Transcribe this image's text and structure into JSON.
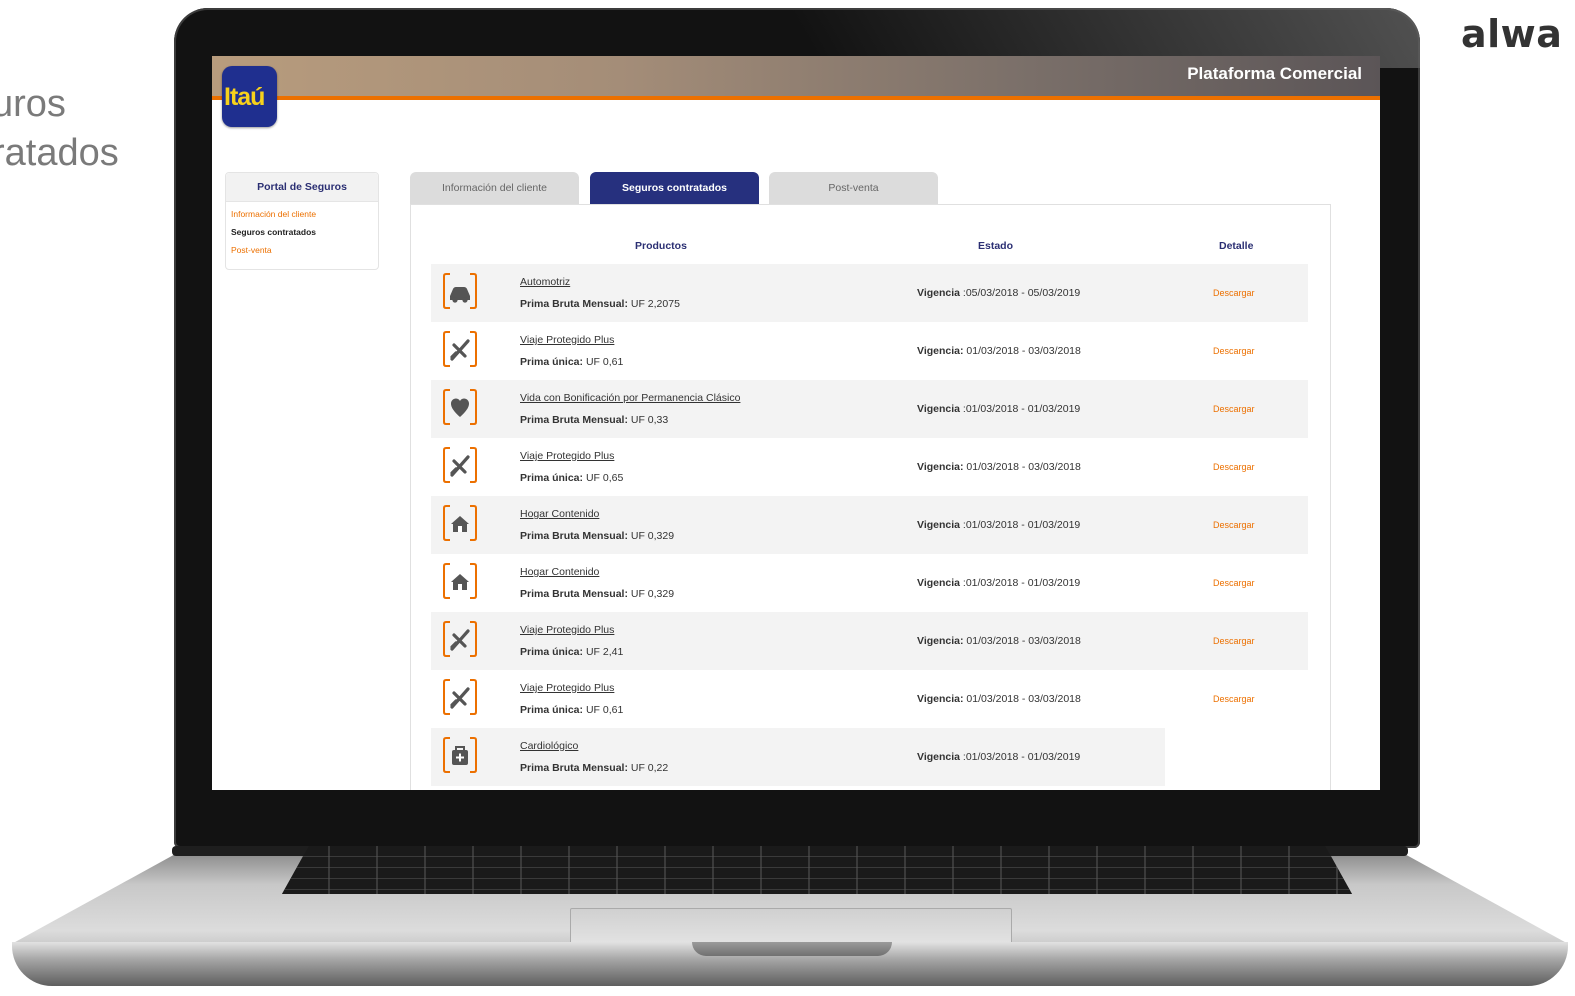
{
  "slide": {
    "title_line1": "uros",
    "title_line2": "ratados",
    "brand_partial": "alwa"
  },
  "header": {
    "logo_text": "Itaú",
    "platform_title": "Plataforma Comercial"
  },
  "sidebar": {
    "title": "Portal de Seguros",
    "items": [
      {
        "label": "Información del cliente",
        "active": false
      },
      {
        "label": "Seguros contratados",
        "active": true
      },
      {
        "label": "Post-venta",
        "active": false
      }
    ]
  },
  "tabs": [
    {
      "label": "Información del cliente",
      "active": false
    },
    {
      "label": "Seguros contratados",
      "active": true
    },
    {
      "label": "Post-venta",
      "active": false
    }
  ],
  "table": {
    "columns": [
      "Productos",
      "Estado",
      "Detalle"
    ],
    "vigencia_label": "Vigencia:",
    "rows": [
      {
        "icon": "car-icon",
        "product": "Automotriz",
        "premium_label": "Prima Bruta Mensual:",
        "premium_value": "UF 2,2075",
        "vigencia_label": "Vigencia",
        "vigencia": ":05/03/2018 - 05/03/2019",
        "action": "Descargar"
      },
      {
        "icon": "plane-icon",
        "product": "Viaje Protegido Plus",
        "premium_label": "Prima única:",
        "premium_value": "UF 0,61",
        "vigencia_label": "Vigencia:",
        "vigencia": "01/03/2018 - 03/03/2018",
        "action": "Descargar"
      },
      {
        "icon": "heart-icon",
        "product": "Vida con Bonificación por Permanencia Clásico",
        "premium_label": "Prima Bruta Mensual:",
        "premium_value": "UF 0,33",
        "vigencia_label": "Vigencia",
        "vigencia": ":01/03/2018 - 01/03/2019",
        "action": "Descargar"
      },
      {
        "icon": "plane-icon",
        "product": "Viaje Protegido Plus",
        "premium_label": "Prima única:",
        "premium_value": "UF 0,65",
        "vigencia_label": "Vigencia:",
        "vigencia": "01/03/2018 - 03/03/2018",
        "action": "Descargar"
      },
      {
        "icon": "house-icon",
        "product": "Hogar Contenido",
        "premium_label": "Prima Bruta Mensual:",
        "premium_value": "UF 0,329",
        "vigencia_label": "Vigencia",
        "vigencia": ":01/03/2018 - 01/03/2019",
        "action": "Descargar"
      },
      {
        "icon": "house-icon",
        "product": "Hogar Contenido",
        "premium_label": "Prima Bruta Mensual:",
        "premium_value": "UF 0,329",
        "vigencia_label": "Vigencia",
        "vigencia": ":01/03/2018 - 01/03/2019",
        "action": "Descargar"
      },
      {
        "icon": "plane-icon",
        "product": "Viaje Protegido Plus",
        "premium_label": "Prima única:",
        "premium_value": "UF 2,41",
        "vigencia_label": "Vigencia:",
        "vigencia": "01/03/2018 - 03/03/2018",
        "action": "Descargar"
      },
      {
        "icon": "plane-icon",
        "product": "Viaje Protegido Plus",
        "premium_label": "Prima única:",
        "premium_value": "UF 0,61",
        "vigencia_label": "Vigencia:",
        "vigencia": "01/03/2018 - 03/03/2018",
        "action": "Descargar"
      },
      {
        "icon": "medical-kit-icon",
        "product": "Cardiológico",
        "premium_label": "Prima Bruta Mensual:",
        "premium_value": "UF 0,22",
        "vigencia_label": "Vigencia",
        "vigencia": ":01/03/2018 - 01/03/2019",
        "action": ""
      }
    ]
  },
  "colors": {
    "brand_orange": "#ec7000",
    "brand_navy": "#26307e",
    "logo_yellow": "#f7d11c"
  }
}
